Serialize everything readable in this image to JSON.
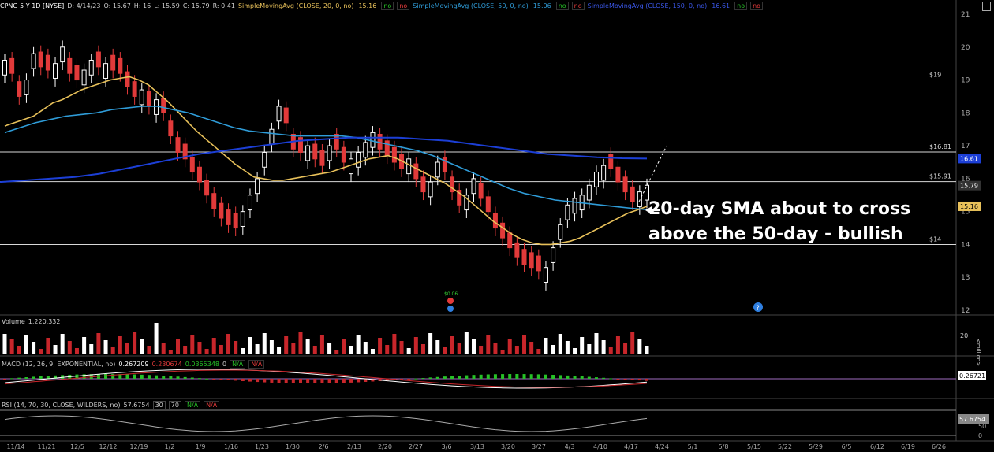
{
  "header": {
    "symbol": "CPNG 5 Y 1D [NYSE]",
    "date": "D: 4/14/23",
    "open": "O: 15.67",
    "high": "H: 16",
    "low": "L: 15.59",
    "close": "C: 15.79",
    "range": "R: 0.41",
    "sma20_label": "SimpleMovingAvg (CLOSE, 20, 0, no)",
    "sma20_value": "15.16",
    "sma50_label": "SimpleMovingAvg (CLOSE, 50, 0, no)",
    "sma50_value": "15.06",
    "sma150_label": "SimpleMovingAvg (CLOSE, 150, 0, no)",
    "sma150_value": "16.61",
    "no": "no"
  },
  "volume_panel": {
    "label": "Volume",
    "value": "1,220,332",
    "axis_label": "<million>",
    "tick": "20"
  },
  "macd_panel": {
    "label": "MACD (12, 26, 9, EXPONENTIAL, no)",
    "v1": "0.267209",
    "v2": "0.230674",
    "v3": "0.0365348",
    "v4": "0",
    "na": "N/A",
    "right_label": "0.26721"
  },
  "rsi_panel": {
    "label": "RSI (14, 70, 30, CLOSE, WILDERS, no)",
    "value": "57.6754",
    "ob": "30",
    "os": "70",
    "na": "N/A",
    "right_label": "57.6754",
    "ticks": [
      "50",
      "0"
    ]
  },
  "annotation": {
    "line1": "20-day SMA about to cross",
    "line2": "above the 50-day - bullish"
  },
  "events": {
    "dividend": "$0.06"
  },
  "colors": {
    "sma20": "#e8c15a",
    "sma50": "#2f9cd8",
    "sma150": "#1c3fd6",
    "up": "#ffffff",
    "down": "#e23a3a",
    "level": "#f0e08a"
  },
  "chart_data": {
    "type": "line",
    "title": "CPNG 5 Y 1D [NYSE]",
    "ylim": [
      12,
      21
    ],
    "y_ticks": [
      12,
      13,
      14,
      15,
      16,
      17,
      18,
      19,
      20,
      21
    ],
    "x_tick_labels": [
      "11/14",
      "11/21",
      "12/5",
      "12/12",
      "12/19",
      "1/2",
      "1/9",
      "1/16",
      "1/23",
      "1/30",
      "2/6",
      "2/13",
      "2/20",
      "2/27",
      "3/6",
      "3/13",
      "3/20",
      "3/27",
      "4/3",
      "4/10",
      "4/17",
      "4/24",
      "5/1",
      "5/8",
      "5/15",
      "5/22",
      "5/29",
      "6/5",
      "6/12",
      "6/19",
      "6/26"
    ],
    "levels": [
      {
        "label": "$19",
        "value": 19
      },
      {
        "label": "$16.81",
        "value": 16.81
      },
      {
        "label": "$15.91",
        "value": 15.91
      },
      {
        "label": "$14",
        "value": 14
      }
    ],
    "price_labels": [
      {
        "label": "16.61",
        "value": 16.61,
        "color": "#1c3fd6"
      },
      {
        "label": "15.79",
        "value": 15.79,
        "color": "#333333"
      },
      {
        "label": "15.16",
        "value": 15.16,
        "color": "#e8c15a"
      }
    ],
    "candles_close": [
      19.6,
      19.2,
      18.5,
      19.0,
      19.8,
      19.4,
      19.3,
      19.5,
      20.0,
      19.2,
      19.0,
      19.3,
      19.6,
      19.4,
      19.5,
      19.3,
      19.2,
      18.8,
      18.5,
      18.7,
      18.2,
      18.4,
      18.0,
      17.3,
      16.8,
      16.6,
      16.2,
      15.9,
      15.5,
      15.1,
      14.8,
      14.6,
      14.5,
      15.0,
      15.5,
      16.0,
      16.8,
      17.5,
      18.2,
      17.7,
      16.9,
      16.8,
      17.0,
      16.6,
      16.4,
      17.0,
      16.9,
      16.5,
      16.6,
      16.8,
      17.1,
      17.4,
      16.9,
      16.7,
      16.5,
      16.3,
      16.6,
      16.0,
      15.6,
      15.9,
      16.5,
      16.2,
      15.6,
      15.2,
      15.5,
      16.0,
      15.4,
      15.0,
      14.5,
      14.2,
      13.9,
      13.6,
      13.4,
      13.3,
      13.2,
      13.3,
      13.9,
      14.6,
      15.2,
      15.4,
      15.5,
      15.8,
      16.2,
      16.4,
      16.3,
      15.9,
      15.6,
      15.3,
      15.6,
      15.8
    ],
    "candles_dir": [
      1,
      0,
      0,
      1,
      1,
      0,
      0,
      1,
      1,
      0,
      0,
      1,
      1,
      0,
      1,
      0,
      0,
      0,
      0,
      1,
      0,
      1,
      0,
      0,
      0,
      0,
      0,
      0,
      0,
      0,
      0,
      0,
      0,
      1,
      1,
      1,
      1,
      1,
      1,
      0,
      0,
      0,
      1,
      0,
      0,
      1,
      0,
      0,
      1,
      1,
      1,
      1,
      0,
      0,
      0,
      0,
      1,
      0,
      0,
      1,
      1,
      0,
      0,
      0,
      1,
      1,
      0,
      0,
      0,
      0,
      0,
      0,
      0,
      0,
      0,
      1,
      1,
      1,
      1,
      1,
      1,
      1,
      1,
      1,
      0,
      0,
      0,
      0,
      1,
      1
    ],
    "series": [
      {
        "name": "SimpleMovingAvg (CLOSE, 20, 0, no)",
        "color": "#e8c15a",
        "values": [
          17.6,
          17.7,
          17.8,
          17.9,
          18.1,
          18.3,
          18.4,
          18.55,
          18.7,
          18.8,
          18.9,
          19.0,
          19.05,
          19.1,
          19.0,
          18.85,
          18.6,
          18.35,
          18.05,
          17.75,
          17.45,
          17.2,
          16.95,
          16.7,
          16.45,
          16.25,
          16.05,
          16.0,
          15.95,
          15.95,
          16.0,
          16.05,
          16.1,
          16.15,
          16.2,
          16.3,
          16.4,
          16.5,
          16.6,
          16.65,
          16.7,
          16.6,
          16.45,
          16.3,
          16.15,
          16.0,
          15.85,
          15.65,
          15.45,
          15.2,
          14.95,
          14.7,
          14.5,
          14.3,
          14.15,
          14.05,
          14.0,
          14.0,
          14.05,
          14.1,
          14.2,
          14.35,
          14.5,
          14.65,
          14.8,
          14.95,
          15.05,
          15.16
        ]
      },
      {
        "name": "SimpleMovingAvg (CLOSE, 50, 0, no)",
        "color": "#2f9cd8",
        "values": [
          17.4,
          17.55,
          17.7,
          17.8,
          17.9,
          17.95,
          18.0,
          18.1,
          18.15,
          18.2,
          18.2,
          18.1,
          18.0,
          17.85,
          17.7,
          17.55,
          17.45,
          17.4,
          17.35,
          17.3,
          17.3,
          17.3,
          17.3,
          17.25,
          17.15,
          17.05,
          16.95,
          16.85,
          16.7,
          16.5,
          16.3,
          16.1,
          15.9,
          15.7,
          15.55,
          15.45,
          15.35,
          15.3,
          15.25,
          15.2,
          15.15,
          15.1,
          15.06
        ]
      },
      {
        "name": "SimpleMovingAvg (CLOSE, 150, 0, no)",
        "color": "#1c3fd6",
        "values": [
          15.9,
          15.95,
          16.0,
          16.05,
          16.15,
          16.3,
          16.45,
          16.6,
          16.75,
          16.85,
          16.95,
          17.05,
          17.15,
          17.2,
          17.25,
          17.25,
          17.25,
          17.2,
          17.15,
          17.05,
          16.95,
          16.85,
          16.75,
          16.7,
          16.65,
          16.62,
          16.61
        ]
      }
    ]
  }
}
